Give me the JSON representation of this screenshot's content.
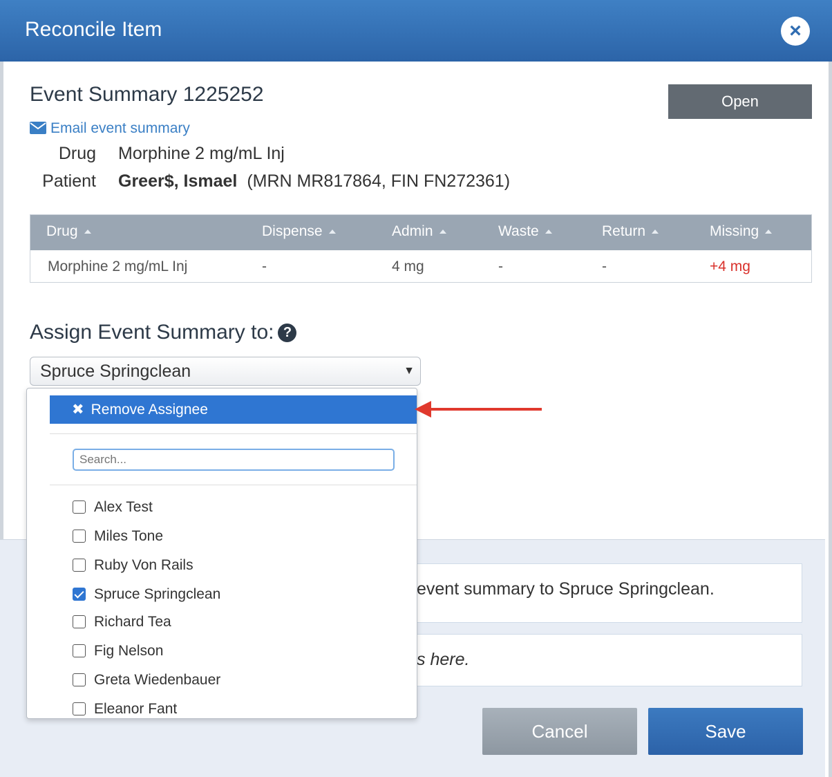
{
  "modal": {
    "title": "Reconcile Item",
    "close_icon": "close-icon"
  },
  "summary": {
    "title": "Event Summary 1225252",
    "status_button": "Open",
    "email_link": "Email event summary",
    "drug_label": "Drug",
    "drug_value": "Morphine 2 mg/mL Inj",
    "patient_label": "Patient",
    "patient_name": "Greer$, Ismael",
    "patient_ids": "(MRN MR817864, FIN FN272361)"
  },
  "table": {
    "columns": [
      "Drug",
      "Dispense",
      "Admin",
      "Waste",
      "Return",
      "Missing"
    ],
    "rows": [
      [
        "Morphine 2 mg/mL Inj",
        "-",
        "4 mg",
        "-",
        "-",
        "+4 mg"
      ]
    ]
  },
  "assign": {
    "label": "Assign Event Summary to:",
    "selected": "Spruce Springclean",
    "caret": "▼"
  },
  "dropdown": {
    "remove_label": "Remove Assignee",
    "remove_icon": "✖",
    "search_placeholder": "Search...",
    "options": [
      {
        "label": "Alex Test",
        "checked": false
      },
      {
        "label": "Miles Tone",
        "checked": false
      },
      {
        "label": "Ruby Von Rails",
        "checked": false
      },
      {
        "label": "Spruce Springclean",
        "checked": true
      },
      {
        "label": "Richard Tea",
        "checked": false
      },
      {
        "label": "Fig Nelson",
        "checked": false
      },
      {
        "label": "Greta Wiedenbauer",
        "checked": false
      },
      {
        "label": "Eleanor Fant",
        "checked": false
      }
    ]
  },
  "footer": {
    "message_partial": "event summary to Spruce Springclean.",
    "comment_partial": "s here.",
    "cancel_label": "Cancel",
    "save_label": "Save"
  },
  "colors": {
    "header": "#2c64a8",
    "accent": "#2f76d2",
    "missing": "#d9312b",
    "annotation_arrow": "#e0392d"
  }
}
